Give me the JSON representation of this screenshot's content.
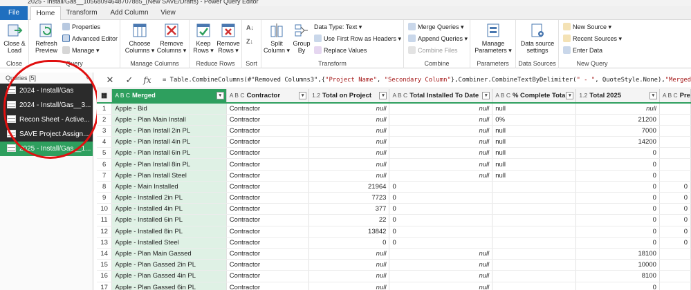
{
  "window": {
    "title": "2025 - Install/Gas__10568094648707885_(New SAVE/Drafts) - Power Query Editor"
  },
  "tabs": [
    {
      "label": "File"
    },
    {
      "label": "Home"
    },
    {
      "label": "Transform"
    },
    {
      "label": "Add Column"
    },
    {
      "label": "View"
    }
  ],
  "ribbon": {
    "close": {
      "close_load": "Close &",
      "close_load2": "Load",
      "group": "Close"
    },
    "query": {
      "refresh": "Refresh",
      "refresh2": "Preview",
      "properties": "Properties",
      "advanced_editor": "Advanced Editor",
      "manage": "Manage",
      "group": "Query"
    },
    "manage_columns": {
      "choose": "Choose",
      "choose2": "Columns",
      "remove": "Remove",
      "remove2": "Columns",
      "group": "Manage Columns"
    },
    "reduce_rows": {
      "keep": "Keep",
      "keep2": "Rows",
      "remove": "Remove",
      "remove2": "Rows",
      "group": "Reduce Rows"
    },
    "sort": {
      "group": "Sort"
    },
    "transform": {
      "split": "Split",
      "split2": "Column",
      "group_by": "Group",
      "group_by2": "By",
      "data_type": "Data Type: Text",
      "first_row": "Use First Row as Headers",
      "replace": "Replace Values",
      "group": "Transform"
    },
    "combine": {
      "merge": "Merge Queries",
      "append": "Append Queries",
      "combine_files": "Combine Files",
      "group": "Combine"
    },
    "parameters": {
      "manage": "Manage",
      "manage2": "Parameters",
      "group": "Parameters"
    },
    "data_sources": {
      "settings": "Data source",
      "settings2": "settings",
      "group": "Data Sources"
    },
    "new_query": {
      "new_source": "New Source",
      "recent_sources": "Recent Sources",
      "enter_data": "Enter Data",
      "group": "New Query"
    }
  },
  "formula_bar": {
    "fx": "fx",
    "p1": "= Table.CombineColumns(#\"Removed Columns3\",{",
    "s1": "\"Project Name\"",
    "p2": ", ",
    "s2": "\"Secondary Column\"",
    "p3": "},Combiner.CombineTextByDelimiter(",
    "s3": "\" - \"",
    "p4": ", QuoteStyle.None),",
    "s4": "\"Merged\"",
    "p5": ")"
  },
  "queries": {
    "header": "Queries [5]",
    "items": [
      {
        "label": "2024 - Install/Gas"
      },
      {
        "label": "2024 - Install/Gas__3..."
      },
      {
        "label": "Recon Sheet - Active..."
      },
      {
        "label": "SAVE Project Assign..."
      },
      {
        "label": "2025 - Install/Gas__1..."
      }
    ]
  },
  "grid": {
    "columns": [
      {
        "type": "A B C",
        "label": "Merged"
      },
      {
        "type": "A B C",
        "label": "Contractor"
      },
      {
        "type": "1.2",
        "label": "Total on Project"
      },
      {
        "type": "A B C",
        "label": "Total Installed To Date"
      },
      {
        "type": "A B C",
        "label": "% Complete Total"
      },
      {
        "type": "1.2",
        "label": "Total 2025"
      },
      {
        "type": "A B C",
        "label": "Pre"
      }
    ],
    "rows": [
      {
        "n": "1",
        "merged": "Apple - Bid",
        "contractor": "Contractor",
        "total": "null",
        "installed": "null",
        "pct": "null",
        "t2025": "null"
      },
      {
        "n": "2",
        "merged": "Apple - Plan Main Install",
        "contractor": "Contractor",
        "total": "null",
        "installed": "null",
        "pct": "0%",
        "t2025": "21200"
      },
      {
        "n": "3",
        "merged": "Apple - Plan Install 2in PL",
        "contractor": "Contractor",
        "total": "null",
        "installed": "null",
        "pct": "null",
        "t2025": "7000"
      },
      {
        "n": "4",
        "merged": "Apple - Plan Install 4in PL",
        "contractor": "Contractor",
        "total": "null",
        "installed": "null",
        "pct": "null",
        "t2025": "14200"
      },
      {
        "n": "5",
        "merged": "Apple - Plan Install 6in PL",
        "contractor": "Contractor",
        "total": "null",
        "installed": "null",
        "pct": "null",
        "t2025": "0"
      },
      {
        "n": "6",
        "merged": "Apple - Plan Install 8in PL",
        "contractor": "Contractor",
        "total": "null",
        "installed": "null",
        "pct": "null",
        "t2025": "0"
      },
      {
        "n": "7",
        "merged": "Apple - Plan Install Steel",
        "contractor": "Contractor",
        "total": "null",
        "installed": "null",
        "pct": "null",
        "t2025": "0"
      },
      {
        "n": "8",
        "merged": "Apple - Main Installed",
        "contractor": "Contractor",
        "total": "21964",
        "installed": "0",
        "pct": "",
        "t2025": "0",
        "pre": "0"
      },
      {
        "n": "9",
        "merged": "Apple - Installed 2in PL",
        "contractor": "Contractor",
        "total": "7723",
        "installed": "0",
        "pct": "",
        "t2025": "0",
        "pre": "0"
      },
      {
        "n": "10",
        "merged": "Apple - Installed 4in PL",
        "contractor": "Contractor",
        "total": "377",
        "installed": "0",
        "pct": "",
        "t2025": "0",
        "pre": "0"
      },
      {
        "n": "11",
        "merged": "Apple - Installed 6in PL",
        "contractor": "Contractor",
        "total": "22",
        "installed": "0",
        "pct": "",
        "t2025": "0",
        "pre": "0"
      },
      {
        "n": "12",
        "merged": "Apple - Installed 8in PL",
        "contractor": "Contractor",
        "total": "13842",
        "installed": "0",
        "pct": "",
        "t2025": "0",
        "pre": "0"
      },
      {
        "n": "13",
        "merged": "Apple - Installed Steel",
        "contractor": "Contractor",
        "total": "0",
        "installed": "0",
        "pct": "",
        "t2025": "0",
        "pre": "0"
      },
      {
        "n": "14",
        "merged": "Apple - Plan Main Gassed",
        "contractor": "Contractor",
        "total": "null",
        "installed": "null",
        "pct": "",
        "t2025": "18100"
      },
      {
        "n": "15",
        "merged": "Apple - Plan Gassed 2in PL",
        "contractor": "Contractor",
        "total": "null",
        "installed": "null",
        "pct": "",
        "t2025": "10000"
      },
      {
        "n": "16",
        "merged": "Apple - Plan Gassed 4in PL",
        "contractor": "Contractor",
        "total": "null",
        "installed": "null",
        "pct": "",
        "t2025": "8100"
      },
      {
        "n": "17",
        "merged": "Apple - Plan Gassed 6in PL",
        "contractor": "Contractor",
        "total": "null",
        "installed": "null",
        "pct": "",
        "t2025": "0"
      }
    ]
  },
  "colors": {
    "accent_green": "#2e9f5e",
    "file_blue": "#1f6fbf",
    "annotation_red": "#e01010"
  }
}
